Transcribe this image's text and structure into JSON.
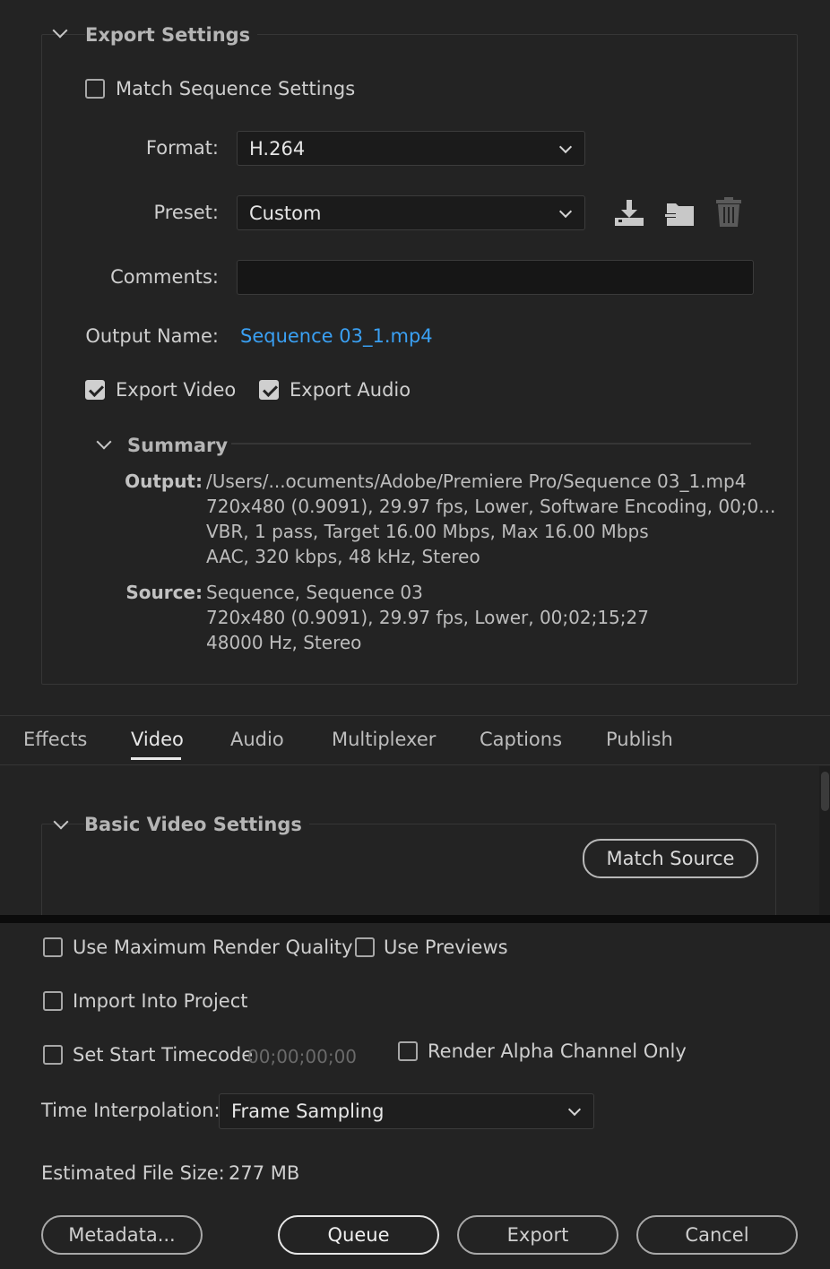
{
  "export_settings": {
    "title": "Export Settings",
    "match_sequence": {
      "label": "Match Sequence Settings",
      "checked": false
    },
    "format": {
      "label": "Format:",
      "value": "H.264"
    },
    "preset": {
      "label": "Preset:",
      "value": "Custom"
    },
    "comments": {
      "label": "Comments:",
      "value": ""
    },
    "output_name": {
      "label": "Output Name:",
      "value": "Sequence 03_1.mp4"
    },
    "export_video": {
      "label": "Export Video",
      "checked": true
    },
    "export_audio": {
      "label": "Export Audio",
      "checked": true
    },
    "summary": {
      "title": "Summary",
      "output_label": "Output:",
      "output_lines": [
        "/Users/...ocuments/Adobe/Premiere Pro/Sequence 03_1.mp4",
        "720x480 (0.9091), 29.97 fps, Lower, Software Encoding, 00;0...",
        "VBR, 1 pass, Target 16.00 Mbps, Max 16.00 Mbps",
        "AAC, 320 kbps, 48 kHz, Stereo"
      ],
      "source_label": "Source:",
      "source_lines": [
        "Sequence, Sequence 03",
        "720x480 (0.9091), 29.97 fps, Lower, 00;02;15;27",
        "48000 Hz, Stereo"
      ]
    },
    "icons": [
      "save-preset-icon",
      "import-preset-icon",
      "delete-preset-icon"
    ]
  },
  "tabs": [
    {
      "label": "Effects",
      "active": false
    },
    {
      "label": "Video",
      "active": true
    },
    {
      "label": "Audio",
      "active": false
    },
    {
      "label": "Multiplexer",
      "active": false
    },
    {
      "label": "Captions",
      "active": false
    },
    {
      "label": "Publish",
      "active": false
    }
  ],
  "video": {
    "section_title": "Basic Video Settings",
    "match_source_label": "Match Source"
  },
  "bottom": {
    "max_render_quality": {
      "label": "Use Maximum Render Quality",
      "checked": false
    },
    "use_previews": {
      "label": "Use Previews",
      "checked": false
    },
    "import_into_project": {
      "label": "Import Into Project",
      "checked": false
    },
    "set_start_timecode": {
      "label": "Set Start Timecode",
      "value": "00;00;00;00",
      "checked": false
    },
    "render_alpha": {
      "label": "Render Alpha Channel Only",
      "checked": false
    },
    "time_interpolation": {
      "label": "Time Interpolation:",
      "value": "Frame Sampling"
    },
    "estimated_file_size": {
      "label": "Estimated File Size:",
      "value": "277 MB"
    },
    "buttons": {
      "metadata": "Metadata...",
      "queue": "Queue",
      "export": "Export",
      "cancel": "Cancel"
    }
  },
  "colors": {
    "background": "#232323",
    "link": "#3aa0f3",
    "field": "#1b1b1b"
  }
}
